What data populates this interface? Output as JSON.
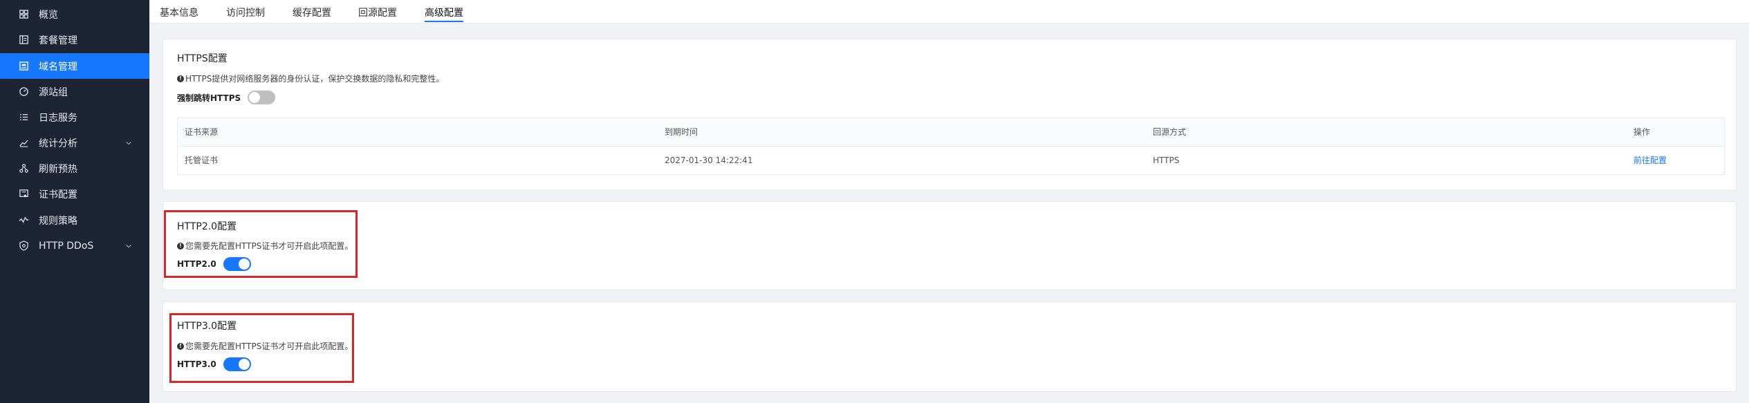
{
  "sidebar": {
    "items": [
      {
        "label": "概览",
        "icon": "grid-icon"
      },
      {
        "label": "套餐管理",
        "icon": "package-icon"
      },
      {
        "label": "域名管理",
        "icon": "domain-icon",
        "active": true
      },
      {
        "label": "源站组",
        "icon": "origin-icon"
      },
      {
        "label": "日志服务",
        "icon": "list-icon"
      },
      {
        "label": "统计分析",
        "icon": "chart-icon",
        "expandable": true
      },
      {
        "label": "刷新预热",
        "icon": "refresh-icon"
      },
      {
        "label": "证书配置",
        "icon": "certificate-icon"
      },
      {
        "label": "规则策略",
        "icon": "rule-icon"
      },
      {
        "label": "HTTP DDoS",
        "icon": "shield-icon",
        "expandable": true
      }
    ]
  },
  "tabs": [
    {
      "label": "基本信息"
    },
    {
      "label": "访问控制"
    },
    {
      "label": "缓存配置"
    },
    {
      "label": "回源配置"
    },
    {
      "label": "高级配置",
      "active": true
    }
  ],
  "https_card": {
    "title": "HTTPS配置",
    "description": "HTTPS提供对网络服务器的身份认证，保护交换数据的隐私和完整性。",
    "force_redirect_label": "强制跳转HTTPS",
    "force_redirect_enabled": false,
    "table": {
      "headers": [
        "证书来源",
        "到期时间",
        "回源方式",
        "操作"
      ],
      "rows": [
        {
          "source": "托管证书",
          "expires": "2027-01-30 14:22:41",
          "origin_protocol": "HTTPS",
          "action": "前往配置"
        }
      ]
    }
  },
  "http2_card": {
    "title": "HTTP2.0配置",
    "description": "您需要先配置HTTPS证书才可开启此项配置。",
    "switch_label": "HTTP2.0",
    "enabled": true
  },
  "http3_card": {
    "title": "HTTP3.0配置",
    "description": "您需要先配置HTTPS证书才可开启此项配置。",
    "switch_label": "HTTP3.0",
    "enabled": true
  },
  "colors": {
    "sidebar_bg": "#1d2433",
    "accent": "#1677ff",
    "highlight_border": "#d9262b"
  }
}
